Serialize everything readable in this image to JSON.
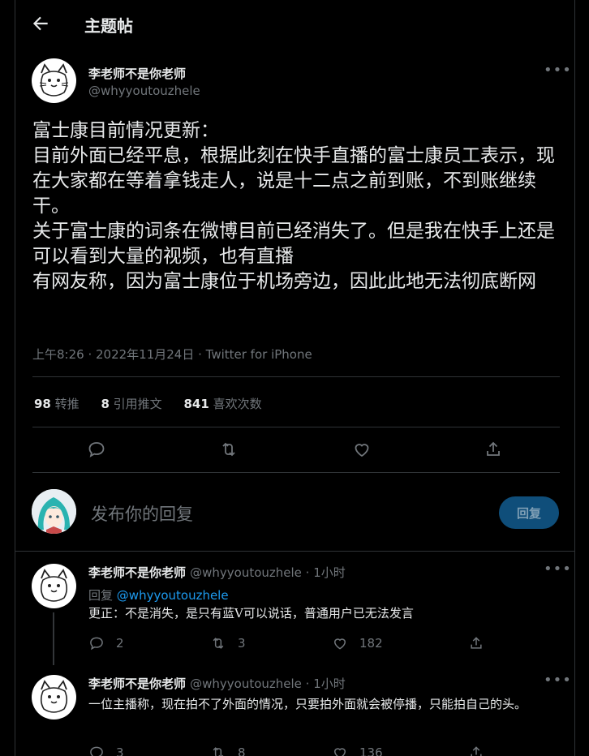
{
  "header": {
    "title": "主题帖"
  },
  "main_tweet": {
    "display_name": "李老师不是你老师",
    "handle": "@whyyoutouzhele",
    "text": "富士康目前情况更新：\n目前外面已经平息，根据此刻在快手直播的富士康员工表示，现在大家都在等着拿钱走人，说是十二点之前到账，不到账继续干。\n关于富士康的词条在微博目前已经消失了。但是我在快手上还是可以看到大量的视频，也有直播\n有网友称，因为富士康位于机场旁边，因此此地无法彻底断网",
    "meta": "上午8:26 · 2022年11月24日 · Twitter for iPhone",
    "stats": {
      "retweets_num": "98",
      "retweets_label": "转推",
      "quotes_num": "8",
      "quotes_label": "引用推文",
      "likes_num": "841",
      "likes_label": "喜欢次数"
    }
  },
  "compose": {
    "placeholder": "发布你的回复",
    "button": "回复"
  },
  "replies": [
    {
      "display_name": "李老师不是你老师",
      "handle_time": "@whyyoutouzhele · 1小时",
      "reply_to_label": "回复",
      "reply_to_handle": "@whyyoutouzhele",
      "text": "更正：不是消失，是只有蓝V可以说话，普通用户已无法发言",
      "replies": "2",
      "retweets": "3",
      "likes": "182"
    },
    {
      "display_name": "李老师不是你老师",
      "handle_time": "@whyyoutouzhele · 1小时",
      "text": "一位主播称，现在拍不了外面的情况，只要拍外面就会被停播，只能拍自己的头。",
      "replies": "3",
      "retweets": "8",
      "likes": "136"
    }
  ],
  "icons": {
    "back": "arrow-left-icon",
    "more": "more-dots-icon",
    "reply": "reply-bubble-icon",
    "retweet": "retweet-icon",
    "like": "heart-icon",
    "share": "share-icon"
  },
  "colors": {
    "accent": "#1d9bf0",
    "background": "#000000",
    "muted": "#71767b",
    "reply_button": "#0f4e7a"
  }
}
